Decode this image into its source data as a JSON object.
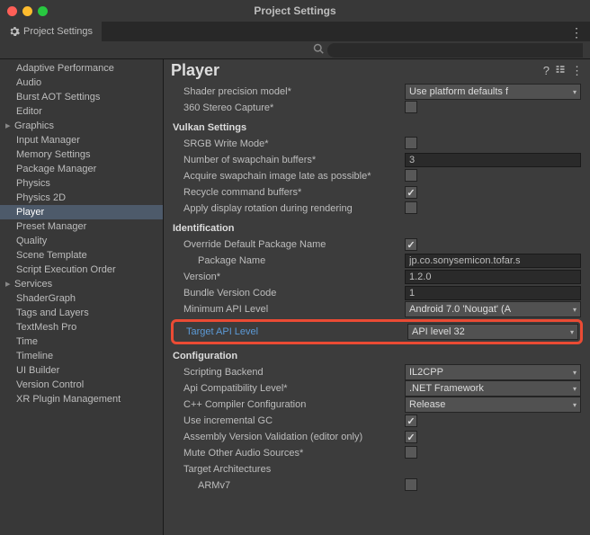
{
  "window": {
    "title": "Project Settings"
  },
  "tab": {
    "label": "Project Settings"
  },
  "sidebar": {
    "items": [
      "Adaptive Performance",
      "Audio",
      "Burst AOT Settings",
      "Editor",
      "Graphics",
      "Input Manager",
      "Memory Settings",
      "Package Manager",
      "Physics",
      "Physics 2D",
      "Player",
      "Preset Manager",
      "Quality",
      "Scene Template",
      "Script Execution Order",
      "Services",
      "ShaderGraph",
      "Tags and Layers",
      "TextMesh Pro",
      "Time",
      "Timeline",
      "UI Builder",
      "Version Control",
      "XR Plugin Management"
    ],
    "selected": "Player",
    "expandable": [
      "Graphics",
      "Services"
    ]
  },
  "content": {
    "title": "Player"
  },
  "settings": {
    "shaderPrecision": {
      "label": "Shader precision model*",
      "value": "Use platform defaults f"
    },
    "stereoCapture": {
      "label": "360 Stereo Capture*",
      "checked": false
    },
    "vulkanSection": "Vulkan Settings",
    "srgbWrite": {
      "label": "SRGB Write Mode*",
      "checked": false
    },
    "swapchainBuffers": {
      "label": "Number of swapchain buffers*",
      "value": "3"
    },
    "acquireLate": {
      "label": "Acquire swapchain image late as possible*",
      "checked": false
    },
    "recycleBuffers": {
      "label": "Recycle command buffers*",
      "checked": true
    },
    "displayRotation": {
      "label": "Apply display rotation during rendering",
      "checked": false
    },
    "identSection": "Identification",
    "overridePackage": {
      "label": "Override Default Package Name",
      "checked": true
    },
    "packageName": {
      "label": "Package Name",
      "value": "jp.co.sonysemicon.tofar.s"
    },
    "version": {
      "label": "Version*",
      "value": "1.2.0"
    },
    "bundleCode": {
      "label": "Bundle Version Code",
      "value": "1"
    },
    "minApi": {
      "label": "Minimum API Level",
      "value": "Android 7.0 'Nougat' (A"
    },
    "targetApi": {
      "label": "Target API Level",
      "value": "API level 32"
    },
    "configSection": "Configuration",
    "scriptingBackend": {
      "label": "Scripting Backend",
      "value": "IL2CPP"
    },
    "apiCompat": {
      "label": "Api Compatibility Level*",
      "value": ".NET Framework"
    },
    "cppCompiler": {
      "label": "C++ Compiler Configuration",
      "value": "Release"
    },
    "incrementalGC": {
      "label": "Use incremental GC",
      "checked": true
    },
    "assemblyValidation": {
      "label": "Assembly Version Validation (editor only)",
      "checked": true
    },
    "muteAudio": {
      "label": "Mute Other Audio Sources*",
      "checked": false
    },
    "targetArch": {
      "label": "Target Architectures"
    },
    "armv7": {
      "label": "ARMv7",
      "checked": false
    }
  }
}
